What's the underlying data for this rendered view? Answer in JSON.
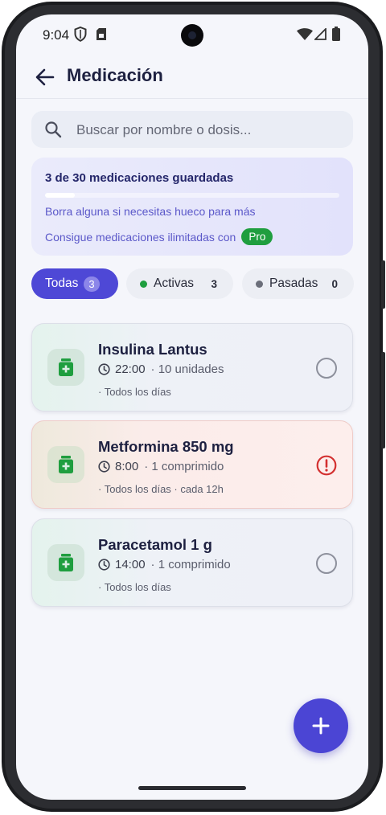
{
  "status_bar": {
    "time": "9:04"
  },
  "header": {
    "title": "Medicación"
  },
  "search": {
    "placeholder": "Buscar por nombre o dosis..."
  },
  "quota": {
    "title": "3 de 30 medicaciones guardadas",
    "used": 3,
    "limit": 30,
    "hint": "Borra alguna si necesitas hueco para más",
    "upgrade_text": "Consigue medicaciones ilimitadas con",
    "pro_badge": "Pro"
  },
  "filters": [
    {
      "label": "Todas",
      "count": "3",
      "selected": true
    },
    {
      "label": "Activas",
      "count": "3",
      "dot_color": "#1f9e3f"
    },
    {
      "label": "Pasadas",
      "count": "0",
      "dot_color": "#6b6e7a"
    }
  ],
  "medications": [
    {
      "name": "Insulina Lantus",
      "time": "22:00",
      "dose": "· 10 unidades",
      "frequency": "· Todos los días",
      "status": "pending"
    },
    {
      "name": "Metformina 850 mg",
      "time": "8:00",
      "dose": "· 1 comprimido",
      "frequency": "· Todos los días · cada 12h",
      "status": "alert"
    },
    {
      "name": "Paracetamol 1 g",
      "time": "14:00",
      "dose": "· 1 comprimido",
      "frequency": "· Todos los días",
      "status": "pending"
    }
  ],
  "colors": {
    "accent": "#4e48d6",
    "success": "#1f9e3f",
    "alert": "#d32f2f",
    "medicine_icon": "#1f9e3f"
  },
  "icons": {
    "back": "arrow-left-icon",
    "search": "search-icon",
    "clock": "clock-icon",
    "medicine": "medicine-bottle-icon",
    "add": "plus-icon"
  }
}
